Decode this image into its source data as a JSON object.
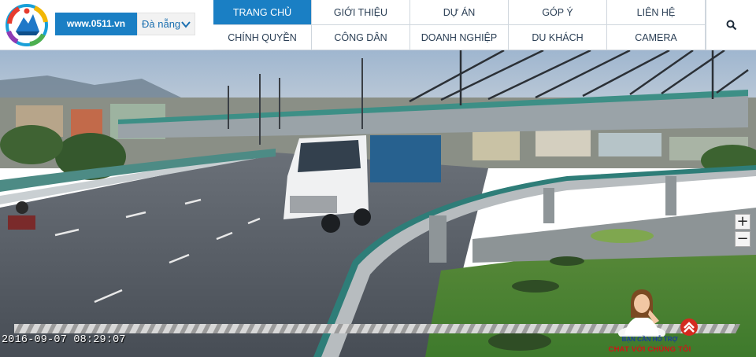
{
  "header": {
    "site_badge": "www.0511.vn",
    "city_select": {
      "selected": "Đà nẵng"
    },
    "nav_top": [
      {
        "label": "TRANG CHỦ",
        "active": true
      },
      {
        "label": "GIỚI THIỆU",
        "active": false
      },
      {
        "label": "DỰ ÁN",
        "active": false
      },
      {
        "label": "GÓP Ý",
        "active": false
      },
      {
        "label": "LIÊN HỆ",
        "active": false
      }
    ],
    "nav_bottom": [
      {
        "label": "CHÍNH QUYỀN"
      },
      {
        "label": "CÔNG DÂN"
      },
      {
        "label": "DOANH NGHIỆP"
      },
      {
        "label": "DU KHÁCH"
      },
      {
        "label": "CAMERA"
      }
    ],
    "search_icon": "search-icon"
  },
  "camera": {
    "timestamp": "2016-09-07 08:29:07",
    "zoom_in": "+",
    "zoom_out": "−"
  },
  "chat": {
    "line1": "BẠN CẦN HỖ TRỢ",
    "line2": "CHAT VỚI CHÚNG TÔI"
  },
  "colors": {
    "brand_blue": "#1a7fc4",
    "nav_text": "#2b3f55",
    "chat_red": "#d01515"
  }
}
